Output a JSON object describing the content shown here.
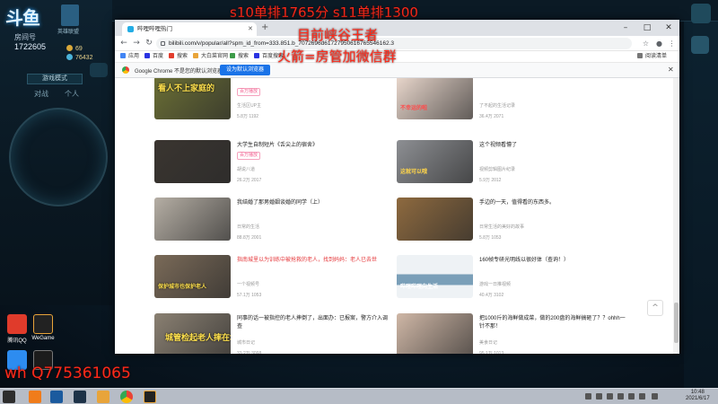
{
  "overlay": {
    "top_banner": "s10单排1765分  s11单排1300",
    "line1": "目前峡谷王者",
    "line2": "火箭=房管加微信群",
    "qq": "wh Q775361065"
  },
  "streamer_panel": {
    "logo_text": "斗鱼",
    "room_label": "房间号",
    "room_number": "1722605",
    "game_logo_label": "英雄联盟",
    "coin1": "69",
    "coin2": "76432",
    "mode_label": "游戏模式",
    "tab1": "对战",
    "tab2": "个人"
  },
  "desktop_icons": [
    {
      "label": "腾讯QQ"
    },
    {
      "label": "WeGame"
    },
    {
      "label": "腾讯"
    }
  ],
  "browser": {
    "tab_title": "哔哩哔哩热门",
    "url": "bilibili.com/v/popular/all?spm_id_from=333.851.b_7072696d61727950616765546162.3",
    "bookmarks": [
      "应用",
      "百度",
      "搜索",
      "大白菜官网",
      "搜索",
      "百度搜索"
    ],
    "reading_list": "阅读清单",
    "infobar": {
      "text": "Google Chrome 不是您的默认浏览器",
      "button": "设为默认浏览器"
    },
    "back_to_top": "^"
  },
  "cards": [
    {
      "title": "",
      "tag": "百万播放",
      "uploader": "生活区UP主",
      "stats": "5.8万   1192",
      "caption": "看人不上家庭的",
      "color": "#6b6f35",
      "title_style": "blur"
    },
    {
      "title": "",
      "tag": "",
      "uploader": "了不起的生活记录",
      "stats": "36.4万   2071",
      "caption": "不幸运的啦",
      "color": "#e9d7cc",
      "title_style": "blur"
    },
    {
      "title": "大学生自制短片《舌尖上的宿舍》",
      "tag": "百万播放",
      "uploader": "胡说八道",
      "stats": "26.2万   2017",
      "caption": "",
      "color": "#3a3530",
      "title_style": ""
    },
    {
      "title": "这个视频看懵了",
      "tag": "",
      "uploader": "视频剪辑图片纪录",
      "stats": "5.9万   2012",
      "caption": "这就可以哦",
      "color": "#8d8f93",
      "title_style": ""
    },
    {
      "title": "我结婚了那男婚姻谈婚的同学（上）",
      "tag": "",
      "uploader": "日常的生活",
      "stats": "88.8万   2001",
      "caption": "",
      "color": "#b5aea4",
      "title_style": ""
    },
    {
      "title": "手边的一天，值得看的东西多。",
      "tag": "",
      "uploader": "日常生活的美好的故事",
      "stats": "5.8万   1053",
      "caption": "",
      "color": "#8e6a3f",
      "title_style": ""
    },
    {
      "title": "指南城里以为训练中被抢救的老人，找到妈妈：老人已去世",
      "tag": "",
      "uploader": "一个视频号",
      "stats": "57.1万   1053",
      "caption": "保护城市也保护老人",
      "color": "#7a6a58",
      "title_style": "red"
    },
    {
      "title": "160帧专研光明线以很好体（查询！）",
      "tag": "",
      "uploader": "游戏一日推视频",
      "stats": "40.4万   3102",
      "caption": "哔哩哔哩向生活",
      "color": "#d7dde3",
      "title_style": ""
    },
    {
      "title": "同事的话一被指控的老人摔倒了，出面办：已报案，警方介入调查",
      "tag": "",
      "uploader": "城市日记",
      "stats": "33.2万   3098",
      "caption": "城管检起老人摔在地上",
      "color": "#8a8072",
      "title_style": ""
    },
    {
      "title": "把1000斤的海鲜做成菜，做的200盘的海鲜搞砸了？？ohhh一针不那！",
      "tag": "",
      "uploader": "美食日记",
      "stats": "95.1万   1013",
      "caption": "",
      "color": "#cfb7a6",
      "title_style": ""
    }
  ],
  "taskbar": {
    "time": "10:48",
    "date": "2021/6/17"
  }
}
